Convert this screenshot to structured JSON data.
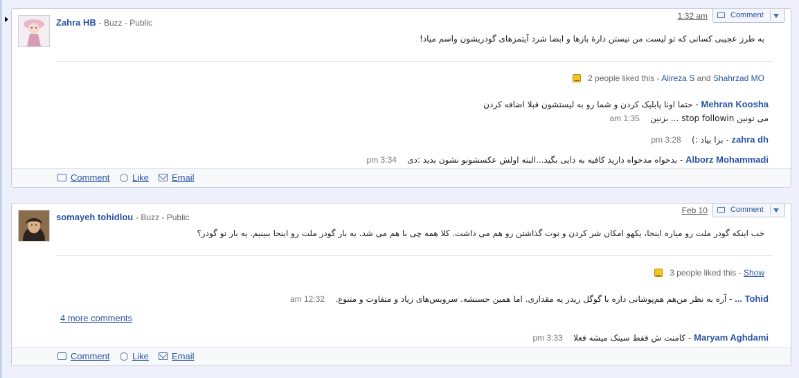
{
  "cards": [
    {
      "author": "Zahra HB",
      "meta": "- Buzz - Public",
      "time": "1:32 am",
      "comment_button": "Comment",
      "post": "به طرز عجیبی کسانی که تو لیست من نیستن دارهٔ بازها و ابضا شرد آیتمزهای گودریشون واسم میاد!",
      "likes": {
        "count_text": "2 people liked this - ",
        "name1": "Alireza S",
        "and": " and ",
        "name2": "Shahrzad MO"
      },
      "comments": [
        {
          "author": "Mehran Koosha",
          "text": " - حتما اونا پابلیک کردن و شما رو به لیستشون قبلا اضافه کردن",
          "line2": "می تونین stop followin ... بزنین",
          "time": "1:35 am"
        },
        {
          "author": "zahra dh",
          "text": " - بزا بیاد :)",
          "time": "3:28 pm"
        },
        {
          "author": "Alborz Mohammadi",
          "text": " - بدخواه مدخواه دارید کافیه به دایی بگید...البته اولش عکسشونو نشون بدید :دی",
          "time": "3:34 pm"
        }
      ],
      "footer": {
        "comment": "Comment",
        "like": "Like",
        "email": "Email"
      }
    },
    {
      "author": "somayeh tohidlou",
      "meta": "- Buzz - Public",
      "time": "Feb 10",
      "comment_button": "Comment",
      "post": "خب اینکه گودر ملت رو میاره اینجا، یکهو امکان شر کردن و نوت گذاشتن رو هم می ذاشت. کلا همه چی با هم می شد. یه بار گودر ملت رو اینجا ببینیم. یه بار تو گودر؟",
      "likes": {
        "count_text": "3 people liked this - ",
        "show": "Show"
      },
      "more_comments": "4 more comments",
      "comments": [
        {
          "author": "Tohid ...",
          "text": " - آره به نظر من‌هم هم‌پوشانی داره با گوگل ریدر یه مقداری. اما همین حسنشه. سرویس‌های زیاد و متفاوت و متنوع.",
          "time": "12:32 am"
        },
        {
          "author": "Maryam Aghdami",
          "text": " - کامنت ش فقط سینک میشه فعلا",
          "time": "3:33 pm"
        }
      ],
      "footer": {
        "comment": "Comment",
        "like": "Like",
        "email": "Email"
      }
    }
  ]
}
